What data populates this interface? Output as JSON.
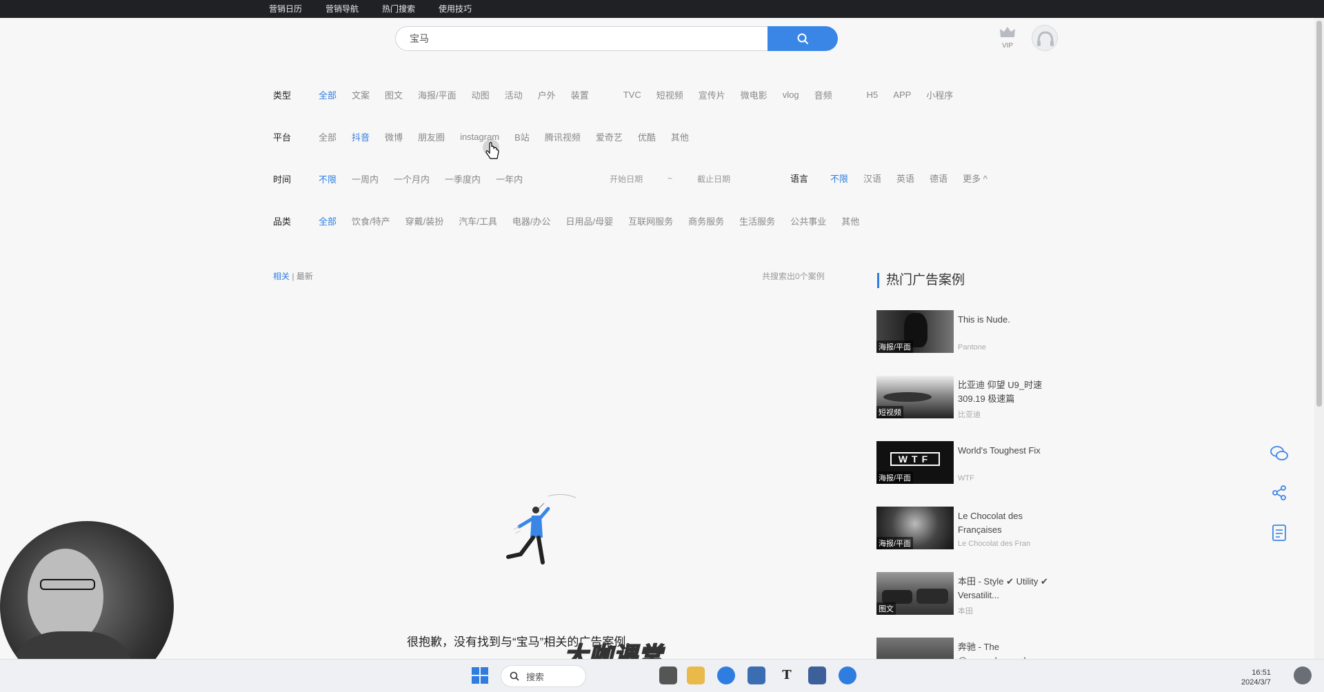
{
  "topnav": [
    "营销日历",
    "营销导航",
    "热门搜索",
    "使用技巧"
  ],
  "search": {
    "value": "宝马"
  },
  "vip_label": "VIP",
  "filters": {
    "type": {
      "label": "类型",
      "options": [
        "全部",
        "文案",
        "图文",
        "海报/平面",
        "动图",
        "活动",
        "户外",
        "装置",
        "TVC",
        "短视频",
        "宣传片",
        "微电影",
        "vlog",
        "音频",
        "H5",
        "APP",
        "小程序"
      ],
      "active": 0
    },
    "platform": {
      "label": "平台",
      "options": [
        "全部",
        "抖音",
        "微博",
        "朋友圈",
        "instagram",
        "B站",
        "腾讯视频",
        "爱奇艺",
        "优酷",
        "其他"
      ],
      "active": 1
    },
    "time": {
      "label": "时间",
      "options": [
        "不限",
        "一周内",
        "一个月内",
        "一季度内",
        "一年内"
      ],
      "active": 0,
      "start_date": "开始日期",
      "separator": "~",
      "end_date": "截止日期"
    },
    "language": {
      "label": "语言",
      "options": [
        "不限",
        "汉语",
        "英语",
        "德语"
      ],
      "active": 0,
      "more": "更多 ^"
    },
    "category": {
      "label": "品类",
      "options": [
        "全部",
        "饮食/特产",
        "穿戴/装扮",
        "汽车/工具",
        "电器/办公",
        "日用品/母婴",
        "互联网服务",
        "商务服务",
        "生活服务",
        "公共事业",
        "其他"
      ],
      "active": 0
    }
  },
  "sort": {
    "relevant": "相关",
    "divider": "|",
    "latest": "最新"
  },
  "result_count": "共搜索出0个案例",
  "hot_title": "热门广告案例",
  "cases": [
    {
      "title": "This is Nude.",
      "brand": "Pantone",
      "tag": "海报/平面"
    },
    {
      "title": "比亚迪 仰望 U9_时速309.19 极速篇",
      "brand": "比亚迪",
      "tag": "短视频"
    },
    {
      "title": "World's Toughest Fix",
      "brand": "WTF",
      "tag": "海报/平面"
    },
    {
      "title": "Le Chocolat des Françaises",
      "brand": "Le Chocolat des Fran",
      "tag": "海报/平面"
    },
    {
      "title": "本田 - Style ✔ Utility ✔ Versatilit...",
      "brand": "本田",
      "tag": "图文"
    },
    {
      "title": "奔驰 - The @mercedesmaub...",
      "brand": "",
      "tag": ""
    }
  ],
  "empty_message": "很抱歉，没有找到与“宝马”相关的广告案例。",
  "taskbar": {
    "search_label": "搜索",
    "time": "16:51",
    "date": "2024/3/7"
  },
  "watermark": "大咖课堂",
  "colors": {
    "accent": "#2f7de1",
    "search_button": "#3a86e6",
    "topbar": "#1f2125"
  }
}
